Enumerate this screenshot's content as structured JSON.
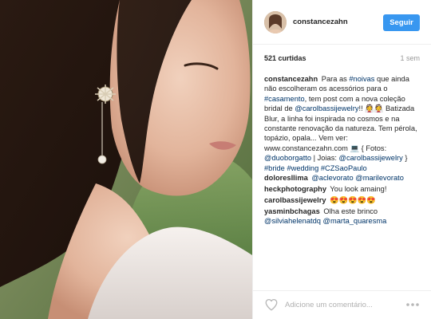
{
  "post": {
    "author": "constancezahn",
    "follow_label": "Seguir",
    "likes": "521 curtidas",
    "time": "1 sem",
    "caption": {
      "author": "constancezahn",
      "t1": "Para as ",
      "l1": "#noivas",
      "t2": " que ainda não escolheram os acessórios para o ",
      "l2": "#casamento",
      "t3": ", tem post com a nova coleção bridal de ",
      "l3": "@carolbassijewelry",
      "t4": "!! 👰👰 Batizada Blur, a linha foi inspirada no cosmos e na constante renovação da natureza. Tem pérola, topázio, opala... Vem ver: www.constancezahn.com 💻 { Fotos: ",
      "l4": "@duoborgatto",
      "t5": " | Joias: ",
      "l5": "@carolbassijewelry",
      "t6": " } ",
      "l6": "#bride",
      "t7": " ",
      "l7": "#wedding",
      "t8": " ",
      "l8": "#CZSaoPaulo"
    },
    "comments": [
      {
        "author": "doloresllima",
        "link1": "@aclevorato",
        "text1": " ",
        "link2": "@marilevorato"
      },
      {
        "author": "heckphotography",
        "text": "You look amaing!"
      },
      {
        "author": "carolbassijewelry",
        "text": "😍😍😍😍😍"
      },
      {
        "author": "yasminbchagas",
        "text": "Olha este brinco",
        "link1": "@silviahelenatdq",
        "link2": "@marta_quaresma"
      }
    ],
    "comment_placeholder": "Adicione um comentário..."
  },
  "icons": {
    "like": "heart-outline-icon",
    "more": "more-dots-icon"
  },
  "colors": {
    "follow_button": "#3897f0",
    "link": "#003569",
    "muted": "#999999",
    "border": "#efefef"
  }
}
